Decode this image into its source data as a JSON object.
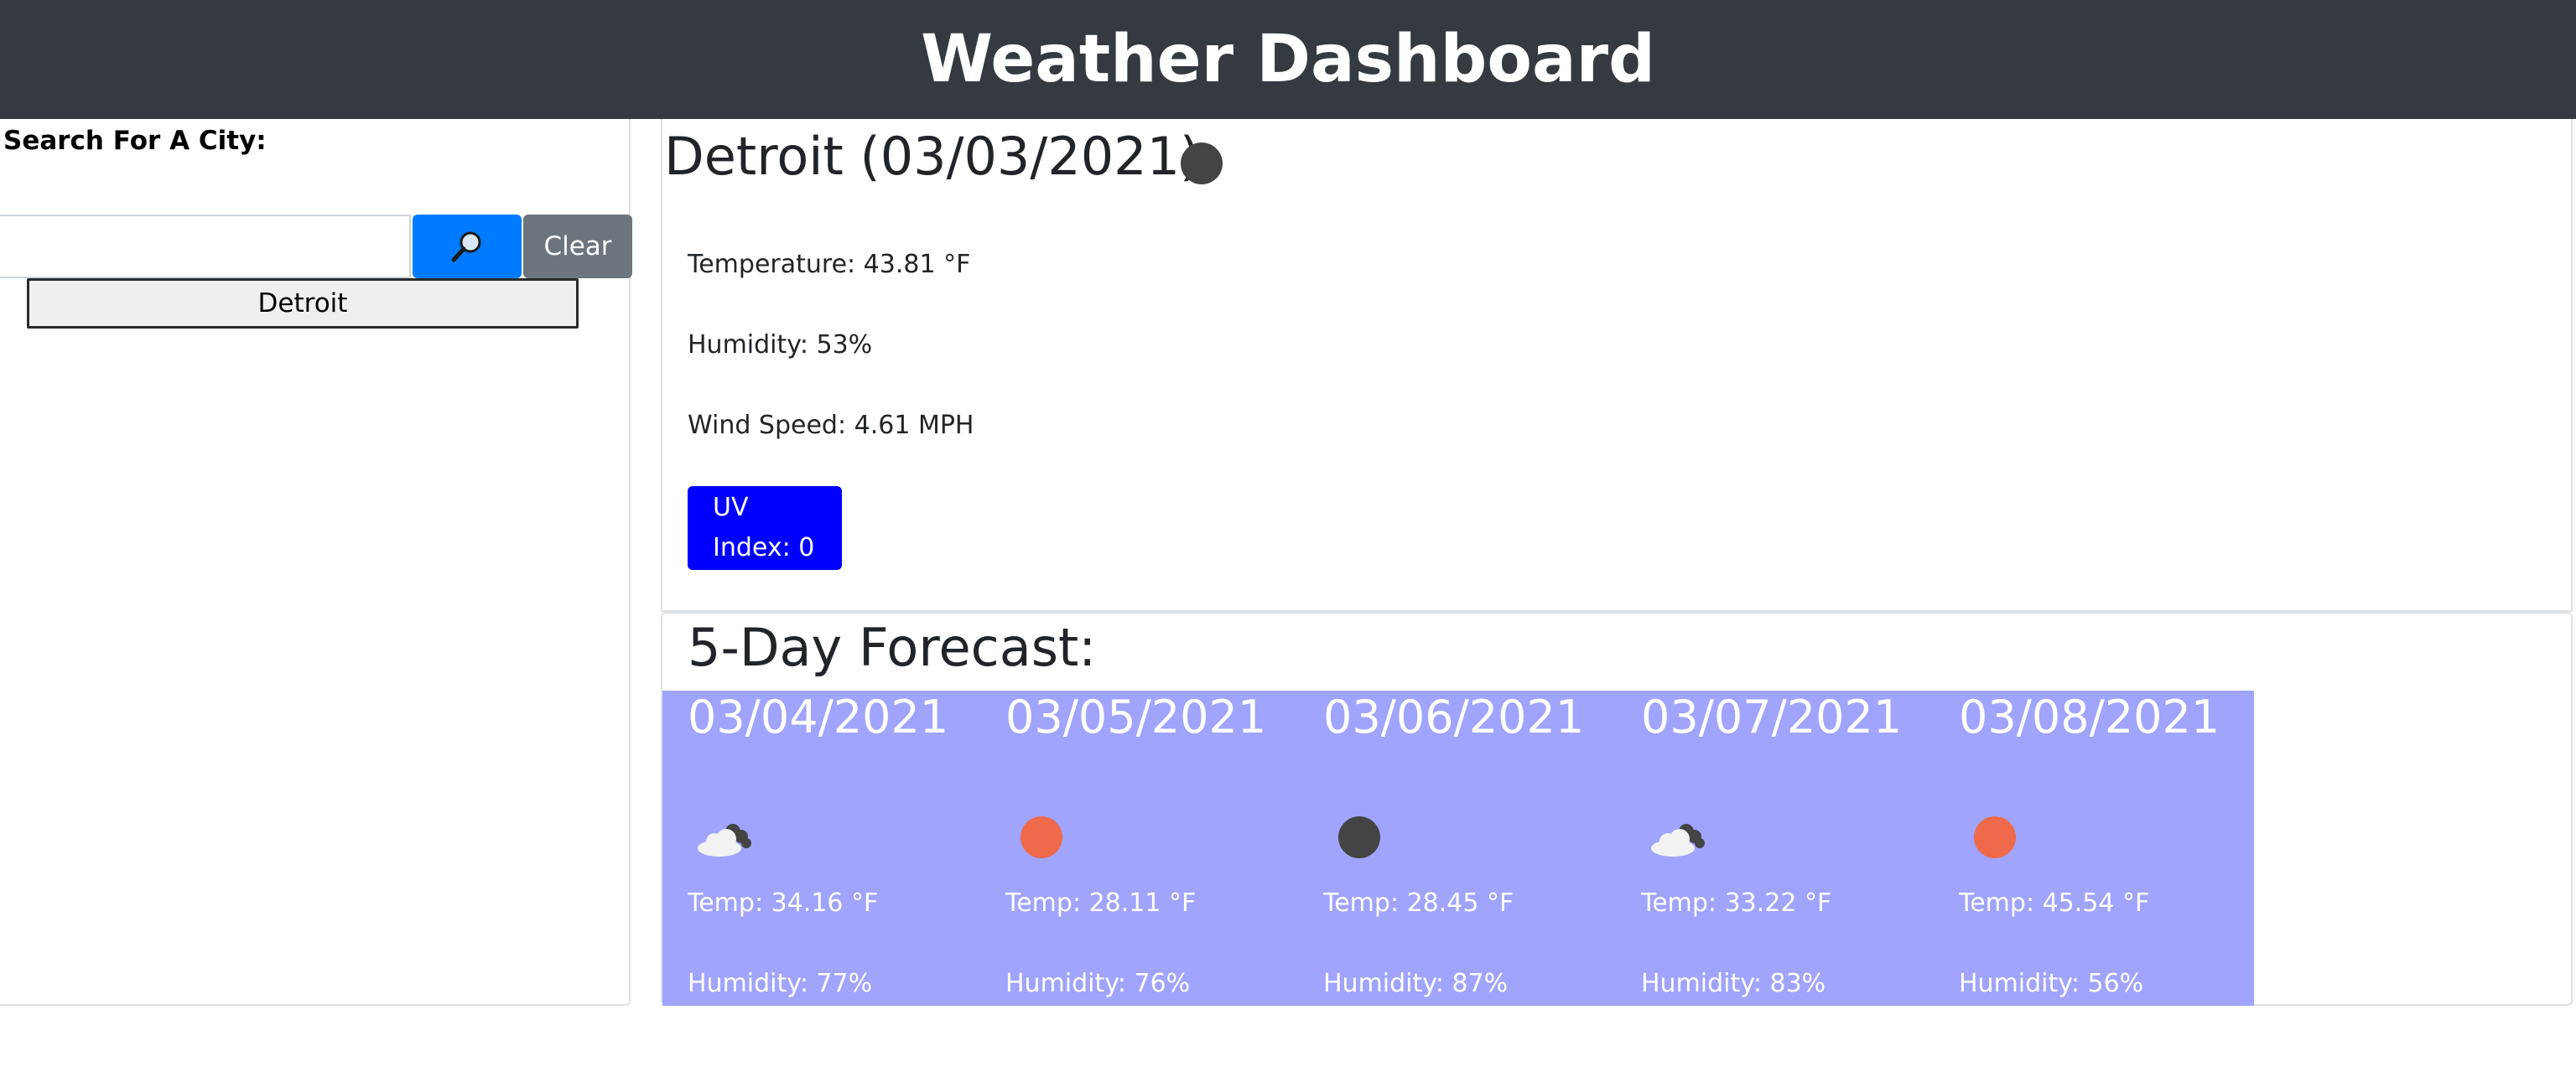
{
  "header": {
    "title": "Weather Dashboard"
  },
  "sidebar": {
    "label": "Search For A City:",
    "search_value": "",
    "clear_label": "Clear",
    "history": [
      "Detroit"
    ]
  },
  "current": {
    "title": "Detroit (03/03/2021)",
    "icon": "moon-icon",
    "temperature": "Temperature: 43.81 °F",
    "humidity": "Humidity: 53%",
    "wind": "Wind Speed: 4.61 MPH",
    "uv_line1": "UV",
    "uv_line2": "Index: 0",
    "uv_color": "#0000ff"
  },
  "forecast": {
    "title": "5-Day Forecast:",
    "days": [
      {
        "date": "03/04/2021",
        "icon": "cloudy-night-icon",
        "temp": "Temp: 34.16 °F",
        "humidity": "Humidity: 77%"
      },
      {
        "date": "03/05/2021",
        "icon": "sun-icon",
        "temp": "Temp: 28.11 °F",
        "humidity": "Humidity: 76%"
      },
      {
        "date": "03/06/2021",
        "icon": "moon-icon",
        "temp": "Temp: 28.45 °F",
        "humidity": "Humidity: 87%"
      },
      {
        "date": "03/07/2021",
        "icon": "cloudy-night-icon",
        "temp": "Temp: 33.22 °F",
        "humidity": "Humidity: 83%"
      },
      {
        "date": "03/08/2021",
        "icon": "sun-icon",
        "temp": "Temp: 45.54 °F",
        "humidity": "Humidity: 56%"
      }
    ]
  },
  "colors": {
    "header_bg": "#343a40",
    "search_button": "#007bff",
    "clear_button": "#6c757d",
    "forecast_bg": "#a0a4fc"
  }
}
